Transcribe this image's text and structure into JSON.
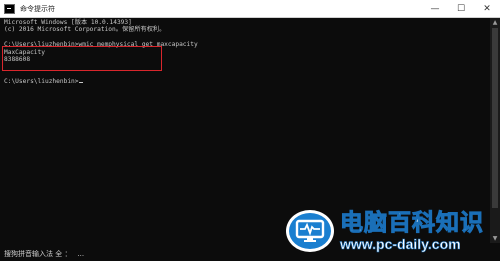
{
  "window": {
    "title": "命令提示符",
    "minimize": "—",
    "maximize": "☐",
    "close": "✕"
  },
  "console": {
    "lines": [
      "Microsoft Windows [版本 10.0.14393]",
      "(c) 2016 Microsoft Corporation。保留所有权利。",
      "",
      "C:\\Users\\liuzhenbin>wmic memphysical get maxcapacity",
      "MaxCapacity",
      "8388608",
      "",
      "",
      "C:\\Users\\liuzhenbin>"
    ]
  },
  "ime": {
    "text": "搜狗拼音输入法 全 ：",
    "extra": "..."
  },
  "watermark": {
    "name": "电脑百科知识",
    "url": "www.pc-daily.com"
  },
  "colors": {
    "console_bg": "#0c0c0c",
    "console_text": "#c8c8c8",
    "highlight": "#d9262c",
    "brand_blue": "#1a7fd0"
  }
}
